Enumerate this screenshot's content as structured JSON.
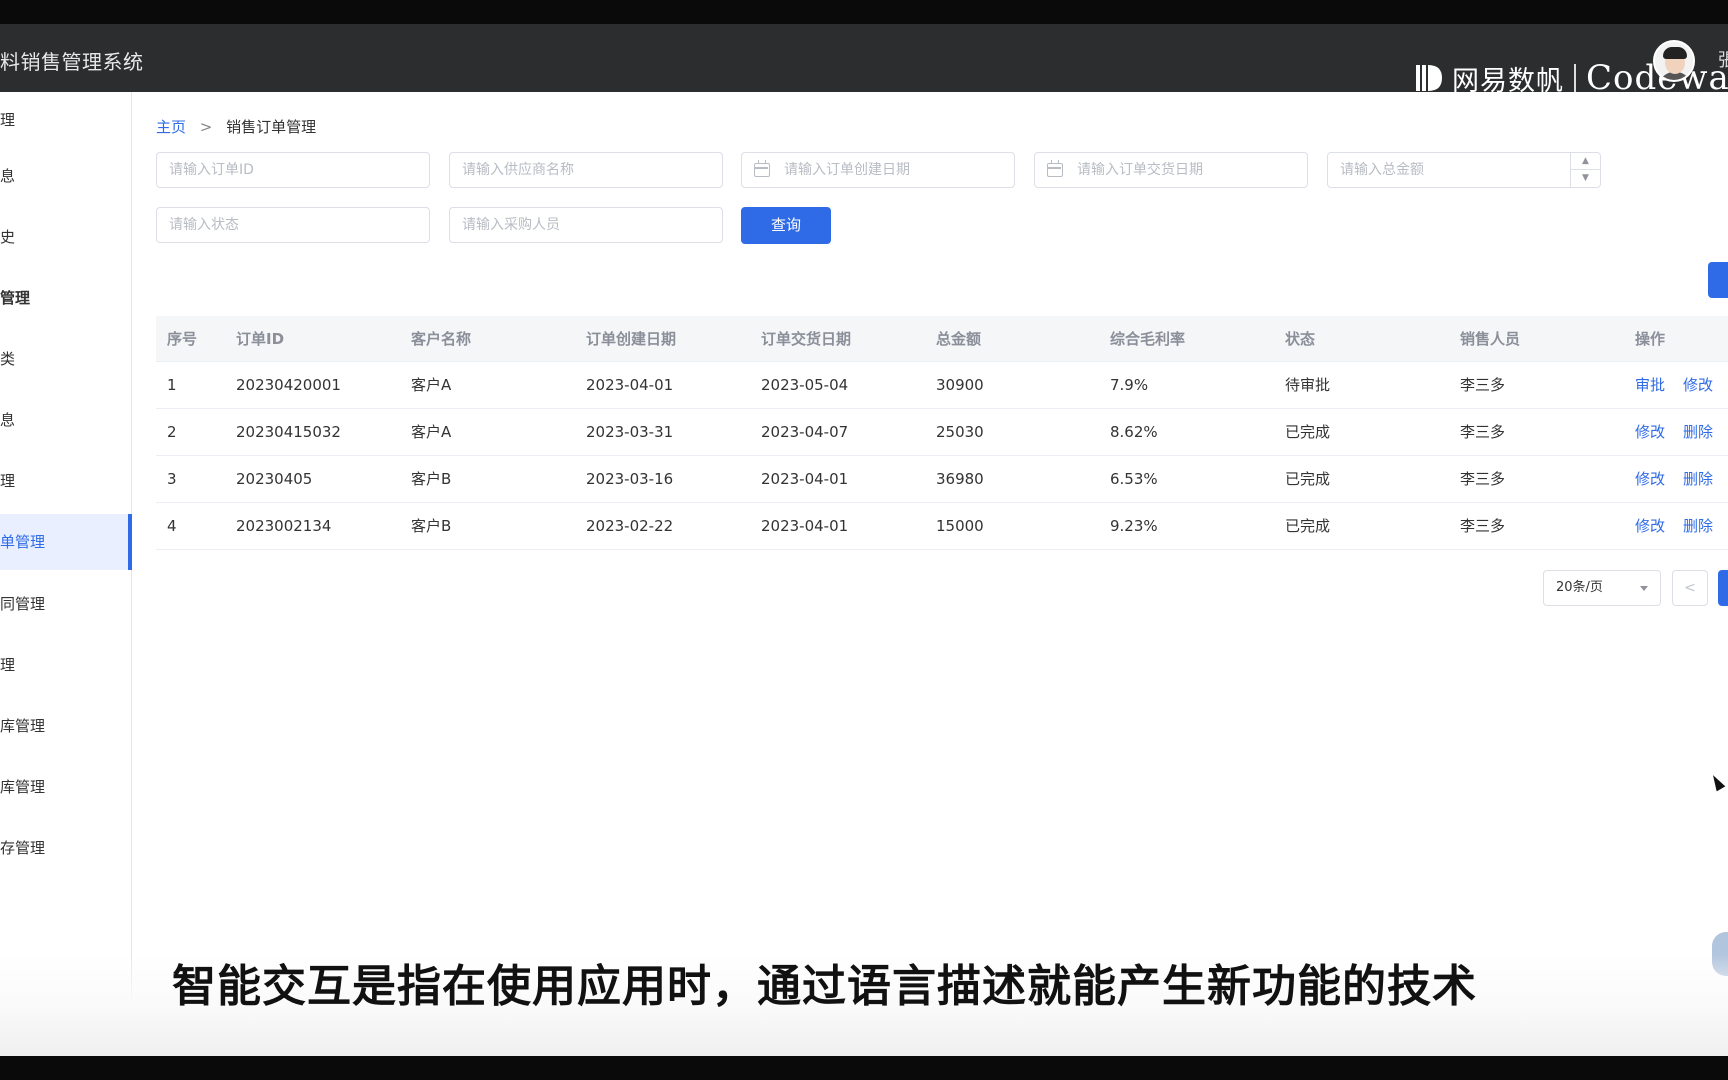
{
  "header": {
    "app_title": "料销售管理系统",
    "brand_cn": "网易数帆",
    "brand_en": "Codewa",
    "user_glyph": "張"
  },
  "sidebar": {
    "items": [
      {
        "label": "理"
      },
      {
        "label": "息"
      },
      {
        "label": "史"
      },
      {
        "label": "管理"
      },
      {
        "label": "类"
      },
      {
        "label": "息"
      },
      {
        "label": "理"
      },
      {
        "label": "单管理"
      },
      {
        "label": "同管理"
      },
      {
        "label": "理"
      },
      {
        "label": "库管理"
      },
      {
        "label": "库管理"
      },
      {
        "label": "存管理"
      }
    ]
  },
  "breadcrumb": {
    "home": "主页",
    "separator": ">",
    "current": "销售订单管理"
  },
  "filters": {
    "order_id_placeholder": "请输入订单ID",
    "supplier_placeholder": "请输入供应商名称",
    "created_date_placeholder": "请输入订单创建日期",
    "delivery_date_placeholder": "请输入订单交货日期",
    "total_placeholder": "请输入总金额",
    "status_placeholder": "请输入状态",
    "purchaser_placeholder": "请输入采购人员",
    "query_label": "查询"
  },
  "table": {
    "columns": [
      "序号",
      "订单ID",
      "客户名称",
      "订单创建日期",
      "订单交货日期",
      "总金额",
      "综合毛利率",
      "状态",
      "销售人员",
      "操作"
    ],
    "rows": [
      {
        "no": "1",
        "order_id": "20230420001",
        "customer": "客户A",
        "created": "2023-04-01",
        "delivery": "2023-05-04",
        "total": "30900",
        "margin": "7.9%",
        "status": "待审批",
        "sales": "李三多",
        "action1": "审批",
        "action2": "修改"
      },
      {
        "no": "2",
        "order_id": "20230415032",
        "customer": "客户A",
        "created": "2023-03-31",
        "delivery": "2023-04-07",
        "total": "25030",
        "margin": "8.62%",
        "status": "已完成",
        "sales": "李三多",
        "action1": "修改",
        "action2": "删除"
      },
      {
        "no": "3",
        "order_id": "20230405",
        "customer": "客户B",
        "created": "2023-03-16",
        "delivery": "2023-04-01",
        "total": "36980",
        "margin": "6.53%",
        "status": "已完成",
        "sales": "李三多",
        "action1": "修改",
        "action2": "删除"
      },
      {
        "no": "4",
        "order_id": "2023002134",
        "customer": "客户B",
        "created": "2023-02-22",
        "delivery": "2023-04-01",
        "total": "15000",
        "margin": "9.23%",
        "status": "已完成",
        "sales": "李三多",
        "action1": "修改",
        "action2": "删除"
      }
    ]
  },
  "pagination": {
    "page_size": "20条/页",
    "prev": "<"
  },
  "subtitle": "智能交互是指在使用应用时，通过语言描述就能产生新功能的技术",
  "colors": {
    "primary": "#2f6be6",
    "header_bg": "#2b2d2e"
  },
  "icons": [
    "calendar-icon",
    "chevron-right-icon",
    "caret-down-icon",
    "stepper-up-icon",
    "stepper-down-icon",
    "brand-logo-icon",
    "avatar",
    "cursor-icon"
  ]
}
